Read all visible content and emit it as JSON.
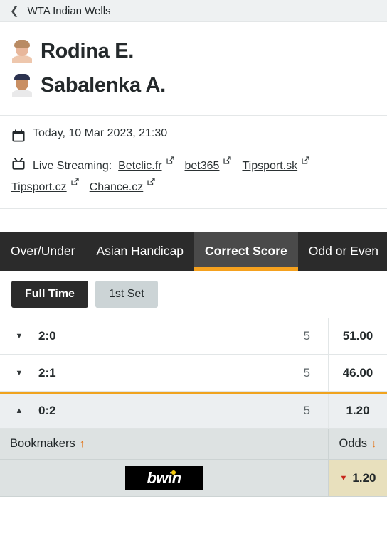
{
  "topbar": {
    "back_icon": "chevron-left-icon",
    "title": "WTA Indian Wells"
  },
  "players": [
    {
      "name": "Rodina E.",
      "avatar": "player-photo"
    },
    {
      "name": "Sabalenka A.",
      "avatar": "player-photo"
    }
  ],
  "info": {
    "calendar_icon": "calendar-icon",
    "datetime": "Today, 10 Mar 2023, 21:30",
    "tv_icon": "tv-icon",
    "streaming_label": "Live Streaming:",
    "streams": [
      "Betclic.fr",
      "bet365",
      "Tipsport.sk",
      "Tipsport.cz",
      "Chance.cz"
    ],
    "external_icon": "external-link-icon"
  },
  "tabs": [
    {
      "label": "Over/Under",
      "active": false
    },
    {
      "label": "Asian Handicap",
      "active": false
    },
    {
      "label": "Correct Score",
      "active": true
    },
    {
      "label": "Odd or Even",
      "active": false
    }
  ],
  "periods": [
    {
      "label": "Full Time",
      "active": true
    },
    {
      "label": "1st Set",
      "active": false
    }
  ],
  "odds_rows": [
    {
      "caret": "▼",
      "score": "2:0",
      "count": "5",
      "odds": "51.00",
      "expanded": false
    },
    {
      "caret": "▼",
      "score": "2:1",
      "count": "5",
      "odds": "46.00",
      "expanded": false
    },
    {
      "caret": "▲",
      "score": "0:2",
      "count": "5",
      "odds": "1.20",
      "expanded": true
    }
  ],
  "bookmakers_header": {
    "left_label": "Bookmakers",
    "left_arrow": "↑",
    "right_label": "Odds",
    "right_arrow": "↓"
  },
  "bookmaker_rows": [
    {
      "name": "bwin",
      "odds": "1.20",
      "trend": "▼"
    }
  ],
  "colors": {
    "accent_orange": "#f0a31e",
    "tab_dark": "#2b2b2b",
    "tab_active": "#4a4a4a",
    "expanded_bg": "#eceff1",
    "bookmaker_bg": "#dde2e2",
    "odds_highlight": "#e8e0bd",
    "trend_down": "#c7271b"
  }
}
